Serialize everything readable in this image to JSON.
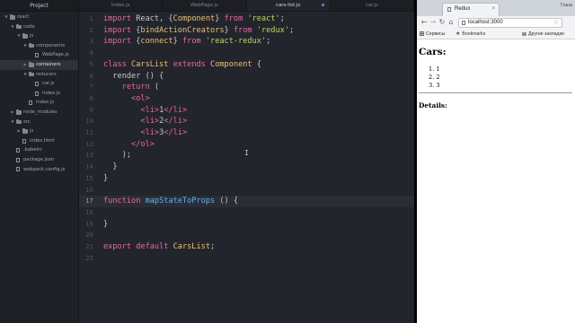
{
  "editor": {
    "sidebar_title": "Project",
    "tree": [
      {
        "label": "react",
        "kind": "folder",
        "depth": 0,
        "expanded": true
      },
      {
        "label": "code",
        "kind": "folder",
        "depth": 1,
        "expanded": true
      },
      {
        "label": "js",
        "kind": "folder",
        "depth": 2,
        "expanded": true
      },
      {
        "label": "components",
        "kind": "folder",
        "depth": 3,
        "expanded": true
      },
      {
        "label": "WebPage.js",
        "kind": "file",
        "depth": 4
      },
      {
        "label": "containers",
        "kind": "folder",
        "depth": 3,
        "expanded": false,
        "selected": true
      },
      {
        "label": "reducers",
        "kind": "folder",
        "depth": 3,
        "expanded": true
      },
      {
        "label": "car.js",
        "kind": "file",
        "depth": 4
      },
      {
        "label": "index.js",
        "kind": "file",
        "depth": 4
      },
      {
        "label": "index.js",
        "kind": "file",
        "depth": 3
      },
      {
        "label": "node_modules",
        "kind": "folder",
        "depth": 1,
        "expanded": false
      },
      {
        "label": "src",
        "kind": "folder",
        "depth": 1,
        "expanded": true
      },
      {
        "label": "js",
        "kind": "folder",
        "depth": 2,
        "expanded": false
      },
      {
        "label": "index.html",
        "kind": "file",
        "depth": 2
      },
      {
        "label": ".babelrc",
        "kind": "file",
        "depth": 1
      },
      {
        "label": "package.json",
        "kind": "file",
        "depth": 1
      },
      {
        "label": "webpack.config.js",
        "kind": "file",
        "depth": 1
      }
    ],
    "tabs": [
      {
        "label": "index.js",
        "active": false,
        "modified": false
      },
      {
        "label": "WebPage.js",
        "active": false,
        "modified": false
      },
      {
        "label": "cars-list.js",
        "active": true,
        "modified": true
      },
      {
        "label": "car.js",
        "active": false,
        "modified": false
      }
    ],
    "current_line": 17,
    "lines": [
      [
        [
          "kw",
          "import "
        ],
        [
          "pl",
          "React, {"
        ],
        [
          "cls",
          "Component"
        ],
        [
          "pl",
          "} "
        ],
        [
          "kw",
          "from "
        ],
        [
          "str",
          "'react'"
        ],
        [
          "pl",
          ";"
        ]
      ],
      [
        [
          "kw",
          "import "
        ],
        [
          "pl",
          "{"
        ],
        [
          "cls",
          "bindActionCreators"
        ],
        [
          "pl",
          "} "
        ],
        [
          "kw",
          "from "
        ],
        [
          "str",
          "'redux'"
        ],
        [
          "pl",
          ";"
        ]
      ],
      [
        [
          "kw",
          "import "
        ],
        [
          "pl",
          "{"
        ],
        [
          "cls",
          "connect"
        ],
        [
          "pl",
          "} "
        ],
        [
          "kw",
          "from "
        ],
        [
          "str",
          "'react-redux'"
        ],
        [
          "pl",
          ";"
        ]
      ],
      [],
      [
        [
          "kw",
          "class "
        ],
        [
          "cls",
          "CarsList "
        ],
        [
          "kw",
          "extends "
        ],
        [
          "cls",
          "Component "
        ],
        [
          "pl",
          "{"
        ]
      ],
      [
        [
          "pl",
          "  render () {"
        ]
      ],
      [
        [
          "kw",
          "    return "
        ],
        [
          "pl",
          "("
        ]
      ],
      [
        [
          "tag",
          "      <ol>"
        ]
      ],
      [
        [
          "tag",
          "        <li>"
        ],
        [
          "pl",
          "1"
        ],
        [
          "tag",
          "</li>"
        ]
      ],
      [
        [
          "tag",
          "        <li>"
        ],
        [
          "pl",
          "2"
        ],
        [
          "tag",
          "</li>"
        ]
      ],
      [
        [
          "tag",
          "        <li>"
        ],
        [
          "pl",
          "3"
        ],
        [
          "tag",
          "</li>"
        ]
      ],
      [
        [
          "tag",
          "      </ol>"
        ]
      ],
      [
        [
          "pl",
          "    );"
        ]
      ],
      [
        [
          "pl",
          "  }"
        ]
      ],
      [
        [
          "pl",
          "}"
        ]
      ],
      [],
      [
        [
          "kw",
          "function "
        ],
        [
          "fn",
          "mapStateToProps "
        ],
        [
          "pl",
          "() {"
        ]
      ],
      [],
      [
        [
          "pl",
          "}"
        ]
      ],
      [],
      [
        [
          "kw",
          "export default "
        ],
        [
          "cls",
          "CarsList"
        ],
        [
          "pl",
          ";"
        ]
      ],
      []
    ],
    "cursor_glyph": "I"
  },
  "browser": {
    "tab_title": "Redux",
    "tab_close": "×",
    "user_name": "Гоша",
    "nav": {
      "back": "←",
      "forward": "→",
      "reload": "↻",
      "home": "⌂"
    },
    "url": "localhost:3000",
    "star": "☆",
    "bookmarks": {
      "apps": "Сервисы",
      "bookmarks": "Bookmarks",
      "other": "Другие закладки"
    },
    "page": {
      "heading": "Cars:",
      "list": [
        "1. 1",
        "2. 2",
        "3. 3"
      ],
      "details_heading": "Details:"
    }
  },
  "colors": {
    "editor_bg": "#23252c",
    "keyword": "#e06c9f",
    "class": "#e5c07b",
    "string": "#b8d86b",
    "function": "#66b0e6"
  }
}
